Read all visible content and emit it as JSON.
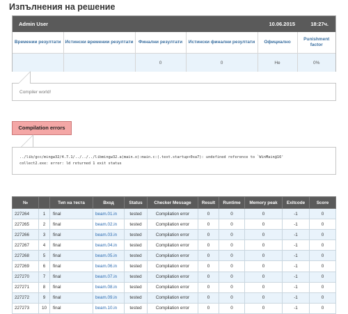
{
  "page": {
    "title": "Изпълнения на решение"
  },
  "summary": {
    "user": "Admin User",
    "date": "10.06.2015",
    "time": "18:27ч.",
    "headers": [
      "Времении резултати",
      "Истински времении резултати",
      "Финални резултати",
      "Истински финални резултати",
      "Официално",
      "Punishment factor"
    ],
    "values": [
      "",
      "",
      "0",
      "0",
      "Не",
      "0%"
    ]
  },
  "compiler": {
    "message": "Compiler world!"
  },
  "errors": {
    "label": "Compilation errors",
    "line1": "../lib/gcc/mingw32/4.7.1/../../../libmingw32.a(main.o):main.c:(.text.startup+0xa7): undefined reference to `WinMain@16'",
    "line2": "collect2.exe: error: ld returned 1 exit status"
  },
  "results": {
    "columns": [
      "№",
      "",
      "Тип на теста",
      "Вход",
      "Status",
      "Checker Message",
      "Result",
      "Runtime",
      "Memory peak",
      "Exitcode",
      "Score"
    ],
    "rows": [
      [
        "227264",
        "1",
        "final",
        "beam.01.in",
        "tested",
        "Compilation error",
        "0",
        "0",
        "0",
        "-1",
        "0"
      ],
      [
        "227265",
        "2",
        "final",
        "beam.02.in",
        "tested",
        "Compilation error",
        "0",
        "0",
        "0",
        "-1",
        "0"
      ],
      [
        "227266",
        "3",
        "final",
        "beam.03.in",
        "tested",
        "Compilation error",
        "0",
        "0",
        "0",
        "-1",
        "0"
      ],
      [
        "227267",
        "4",
        "final",
        "beam.04.in",
        "tested",
        "Compilation error",
        "0",
        "0",
        "0",
        "-1",
        "0"
      ],
      [
        "227268",
        "5",
        "final",
        "beam.05.in",
        "tested",
        "Compilation error",
        "0",
        "0",
        "0",
        "-1",
        "0"
      ],
      [
        "227269",
        "6",
        "final",
        "beam.06.in",
        "tested",
        "Compilation error",
        "0",
        "0",
        "0",
        "-1",
        "0"
      ],
      [
        "227270",
        "7",
        "final",
        "beam.07.in",
        "tested",
        "Compilation error",
        "0",
        "0",
        "0",
        "-1",
        "0"
      ],
      [
        "227271",
        "8",
        "final",
        "beam.08.in",
        "tested",
        "Compilation error",
        "0",
        "0",
        "0",
        "-1",
        "0"
      ],
      [
        "227272",
        "9",
        "final",
        "beam.09.in",
        "tested",
        "Compilation error",
        "0",
        "0",
        "0",
        "-1",
        "0"
      ],
      [
        "227273",
        "10",
        "final",
        "beam.10.in",
        "tested",
        "Compilation error",
        "0",
        "0",
        "0",
        "-1",
        "0"
      ]
    ]
  },
  "colors": {
    "header_bg": "#5a5a5a",
    "row_alt": "#e9f3fb",
    "error_badge": "#f4a7a6",
    "link": "#2a6ab0"
  }
}
